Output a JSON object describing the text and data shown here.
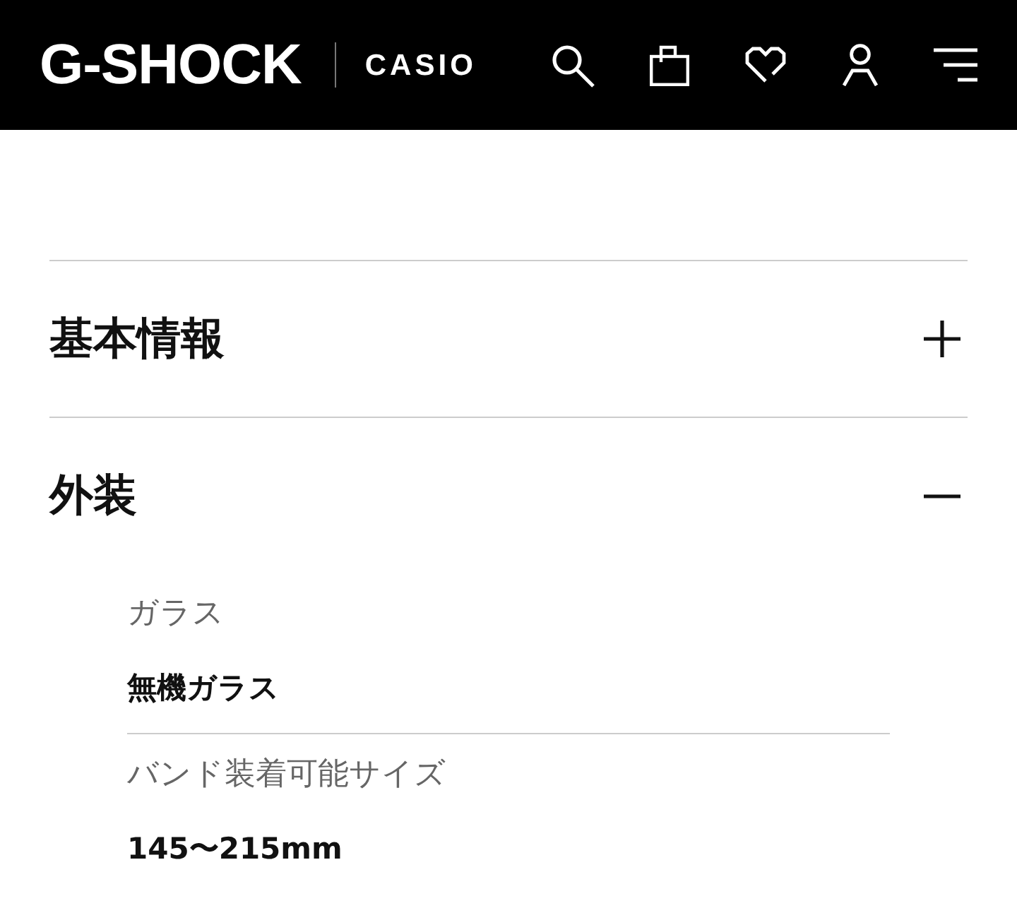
{
  "header": {
    "logo": "G-SHOCK",
    "brand": "CASIO"
  },
  "sections": [
    {
      "title": "基本情報",
      "expanded": false
    },
    {
      "title": "外装",
      "expanded": true,
      "specs": [
        {
          "label": "ガラス",
          "value": "無機ガラス"
        },
        {
          "label": "バンド装着可能サイズ",
          "value": "145〜215mm"
        }
      ]
    }
  ]
}
